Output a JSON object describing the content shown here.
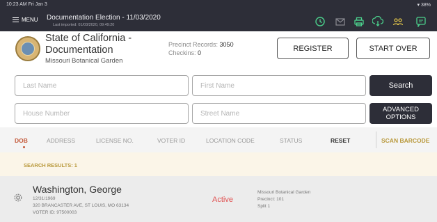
{
  "status_bar": {
    "time": "10:23 AM  Fri Jan 3",
    "battery": "38%"
  },
  "header": {
    "menu_label": "MENU",
    "title": "Documentation Election - 11/03/2020",
    "subtitle": "Last imported: 01/03/2020, 09:49:20",
    "icons": [
      "clock-icon",
      "mail-icon",
      "printer-icon",
      "sync-icon",
      "users-icon",
      "chat-icon"
    ]
  },
  "info": {
    "org_line1": "State of California -",
    "org_line2": "Documentation",
    "org_sub": "Missouri Botanical Garden",
    "precinct_label": "Precinct Records:",
    "precinct_value": "3050",
    "checkins_label": "Checkins:",
    "checkins_value": "0",
    "register_label": "REGISTER",
    "startover_label": "START OVER"
  },
  "search": {
    "last_name_placeholder": "Last Name",
    "first_name_placeholder": "First Name",
    "house_number_placeholder": "House Number",
    "street_name_placeholder": "Street Name",
    "search_label": "Search",
    "advanced_line1": "ADVANCED",
    "advanced_line2": "OPTIONS"
  },
  "filters": {
    "dob": "DOB",
    "address": "ADDRESS",
    "license": "LICENSE NO.",
    "voter_id": "VOTER ID",
    "location_code": "LOCATION CODE",
    "status": "STATUS",
    "reset": "RESET",
    "scan_barcode": "SCAN BARCODE"
  },
  "results": {
    "label": "SEARCH RESULTS: 1",
    "items": [
      {
        "name": "Washington, George",
        "dob": "12/31/1969",
        "address": "320 BRANCASTER AVE, ST LOUIS, MO 63134",
        "voter_id": "VOTER ID: 97500003",
        "status": "Active",
        "location": "Missouri Botanical Garden",
        "precinct": "Precinct: 101",
        "split": "Split 1"
      }
    ]
  },
  "colors": {
    "header_bg": "#2d2e38",
    "icon_green": "#4bd08c",
    "accent_orange": "#c45a3b",
    "scan_gold": "#b8983a",
    "status_red": "#e05050"
  }
}
